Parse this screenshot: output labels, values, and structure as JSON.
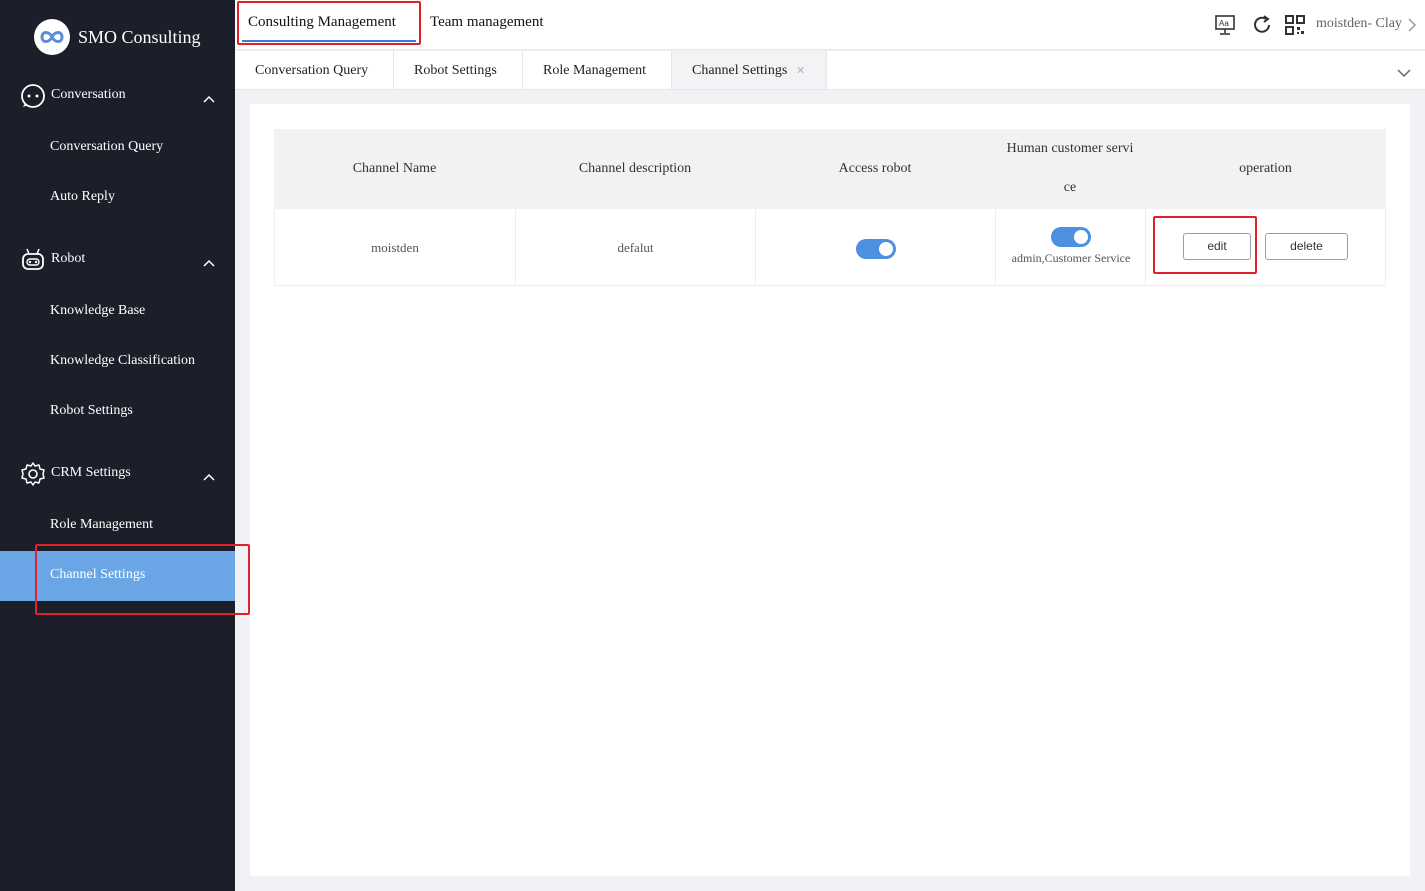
{
  "app": {
    "name": "SMO Consulting"
  },
  "sidebar": {
    "groups": [
      {
        "label": "Conversation",
        "icon": "chat-face-icon",
        "items": [
          {
            "label": "Conversation Query"
          },
          {
            "label": "Auto Reply"
          }
        ]
      },
      {
        "label": "Robot",
        "icon": "robot-icon",
        "items": [
          {
            "label": "Knowledge Base"
          },
          {
            "label": "Knowledge Classification"
          },
          {
            "label": "Robot Settings"
          }
        ]
      },
      {
        "label": "CRM Settings",
        "icon": "gear-icon",
        "items": [
          {
            "label": "Role Management"
          },
          {
            "label": "Channel Settings",
            "active": true
          }
        ]
      }
    ]
  },
  "header": {
    "top_tabs": [
      {
        "label": "Consulting Management",
        "active": true
      },
      {
        "label": "Team management"
      }
    ],
    "user": "moistden- Clay",
    "icons": [
      "translate-icon",
      "refresh-icon",
      "qr-code-icon",
      "chevron-right-icon"
    ]
  },
  "tabs": [
    {
      "label": "Conversation Query"
    },
    {
      "label": "Robot Settings"
    },
    {
      "label": "Role Management"
    },
    {
      "label": "Channel Settings",
      "active": true,
      "closable": true
    }
  ],
  "table": {
    "columns": [
      "Channel Name",
      "Channel description",
      "Access robot",
      "Human customer servi",
      "ce",
      "operation"
    ],
    "rows": [
      {
        "channel_name": "moistden",
        "description": "defalut",
        "access_robot": true,
        "human_service_enabled": true,
        "human_service": "admin,Customer Service",
        "actions": [
          "edit",
          "delete"
        ]
      }
    ]
  },
  "colors": {
    "sidebar_bg": "#1c1e2a",
    "active_item": "#6aa6e6",
    "switch_on": "#4d8fe0",
    "highlight": "#e0202a"
  }
}
